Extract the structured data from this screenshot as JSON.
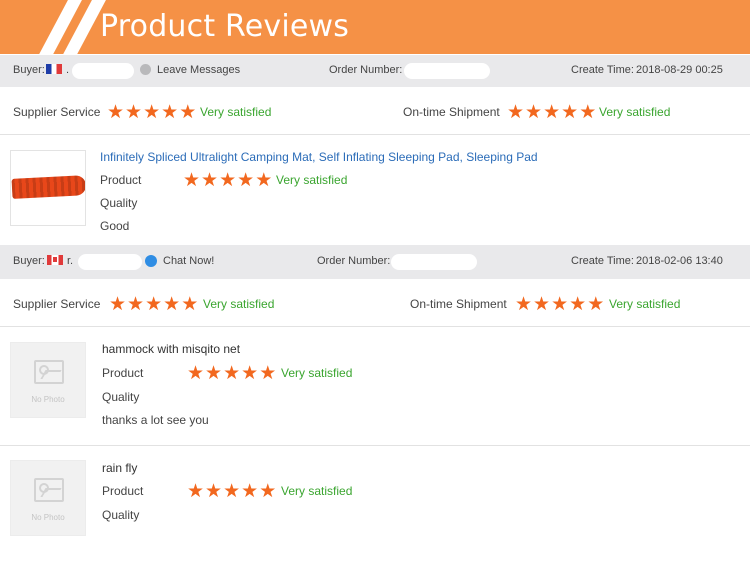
{
  "banner": {
    "title": "Product Reviews"
  },
  "reviews": [
    {
      "buyer_label": "Buyer:",
      "buyer_name": ".",
      "buyer_flag": "flag-fr",
      "buyer_action": "Leave Messages",
      "order_label": "Order Number:",
      "create_label": "Create Time:",
      "create_time": "2018-08-29 00:25",
      "supplier_label": "Supplier Service",
      "supplier_stars": 5,
      "supplier_text": "Very satisfied",
      "shipment_label": "On-time Shipment",
      "shipment_stars": 5,
      "shipment_text": "Very satisfied",
      "products": [
        {
          "title": "Infinitely Spliced Ultralight Camping Mat, Self Inflating Sleeping Pad, Sleeping Pad",
          "product_label": "Product",
          "quality_label": "Quality",
          "stars": 5,
          "satisfaction": "Very satisfied",
          "comment": "Good",
          "photo": "camping-mat"
        }
      ]
    },
    {
      "buyer_label": "Buyer:",
      "buyer_name": "r.",
      "buyer_flag": "flag-ca",
      "buyer_action": "Chat Now!",
      "order_label": "Order Number:",
      "create_label": "Create Time:",
      "create_time": "2018-02-06 13:40",
      "supplier_label": "Supplier Service",
      "supplier_stars": 5,
      "supplier_text": "Very satisfied",
      "shipment_label": "On-time Shipment",
      "shipment_stars": 5,
      "shipment_text": "Very satisfied",
      "products": [
        {
          "title": "hammock with misqito net",
          "product_label": "Product",
          "quality_label": "Quality",
          "stars": 5,
          "satisfaction": "Very satisfied",
          "comment": "thanks a lot see you",
          "photo": "no-photo",
          "no_photo_text": "No Photo"
        },
        {
          "title": "rain fly",
          "product_label": "Product",
          "quality_label": "Quality",
          "stars": 5,
          "satisfaction": "Very satisfied",
          "comment": "",
          "photo": "no-photo",
          "no_photo_text": "No Photo"
        }
      ]
    }
  ],
  "colors": {
    "banner": "#f59146",
    "star": "#f2681f",
    "satisfied": "#3aa52f",
    "link": "#2b6cb8"
  },
  "icons": {
    "star": "star-icon",
    "message": "message-icon",
    "chat": "chat-icon"
  }
}
